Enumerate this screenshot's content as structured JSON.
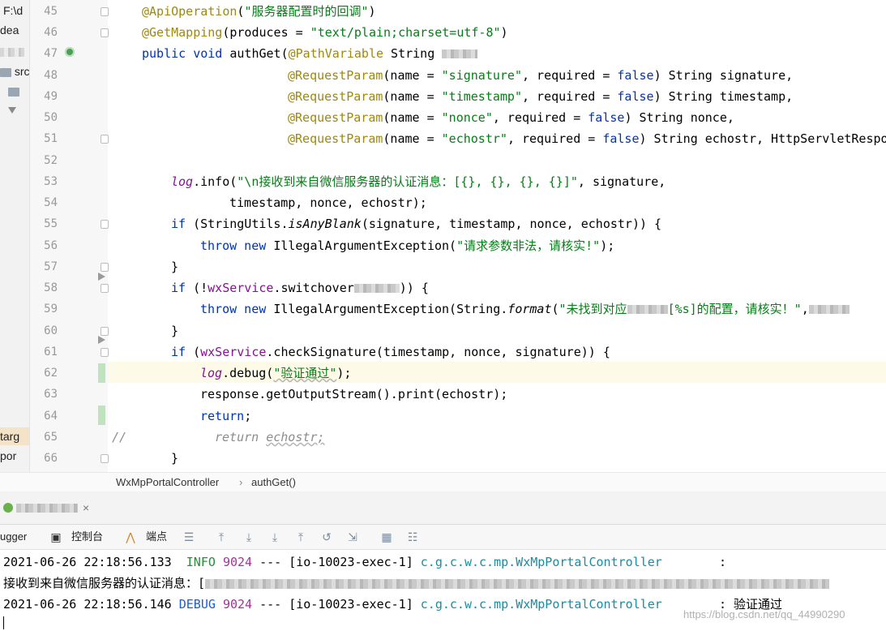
{
  "project": {
    "path_partial": "F:\\d",
    "idea_partial": "dea",
    "src_label": "src",
    "target_partial": "targ",
    "pom_partial": "por"
  },
  "editor": {
    "lines": [
      45,
      46,
      47,
      48,
      49,
      50,
      51,
      52,
      53,
      54,
      55,
      56,
      57,
      58,
      59,
      60,
      61,
      62,
      63,
      64,
      65,
      66
    ],
    "code": {
      "l45_ann": "@ApiOperation",
      "l45_p1": "(",
      "l45_str": "\"服务器配置时的回调\"",
      "l45_p2": ")",
      "l46_ann": "@GetMapping",
      "l46_p1": "(produces = ",
      "l46_str": "\"text/plain;charset=utf-8\"",
      "l46_p2": ")",
      "l47_kw": "public void ",
      "l47_name": "authGet(",
      "l47_ann": "@PathVariable",
      "l47_type": " String ",
      "l48_ann": "@RequestParam",
      "l48_p1": "(name = ",
      "l48_str": "\"signature\"",
      "l48_p2": ", required = ",
      "l48_kw": "false",
      "l48_p3": ") String signature,",
      "l49_ann": "@RequestParam",
      "l49_p1": "(name = ",
      "l49_str": "\"timestamp\"",
      "l49_p2": ", required = ",
      "l49_kw": "false",
      "l49_p3": ") String timestamp,",
      "l50_ann": "@RequestParam",
      "l50_p1": "(name = ",
      "l50_str": "\"nonce\"",
      "l50_p2": ", required = ",
      "l50_kw": "false",
      "l50_p3": ") String nonce,",
      "l51_ann": "@RequestParam",
      "l51_p1": "(name = ",
      "l51_str": "\"echostr\"",
      "l51_p2": ", required = ",
      "l51_kw": "false",
      "l51_p3": ") String echostr, HttpServletRespo",
      "l53_fld": "log",
      "l53_p1": ".info(",
      "l53_str": "\"\\n接收到来自微信服务器的认证消息：[{}, {}, {}, {}]\"",
      "l53_p2": ", signature,",
      "l54": "timestamp, nonce, echostr);",
      "l55_kw": "if ",
      "l55_p1": "(StringUtils.",
      "l55_it": "isAnyBlank",
      "l55_p2": "(signature, timestamp, nonce, echostr)) {",
      "l56_kw": "throw new ",
      "l56_p1": "IllegalArgumentException(",
      "l56_str": "\"请求参数非法，请核实!\"",
      "l56_p2": ");",
      "l57": "}",
      "l58_kw": "if ",
      "l58_p1": "(!",
      "l58_fld": "wxService",
      "l58_p2": ".switchover",
      "l58_p3": ")) {",
      "l59_kw": "throw new ",
      "l59_p1": "IllegalArgumentException(String.",
      "l59_it": "format",
      "l59_p2": "(",
      "l59_str1": "\"未找到对应",
      "l59_str2": "[%s]的配置，请核实！\"",
      "l59_p3": ",",
      "l60": "}",
      "l61_kw": "if ",
      "l61_p1": "(",
      "l61_fld": "wxService",
      "l61_p2": ".checkSignature(timestamp, nonce, signature)) {",
      "l62_fld": "log",
      "l62_p1": ".debug(",
      "l62_str": "\"验证通过\"",
      "l62_p2": ");",
      "l63": "response.getOutputStream().print(echostr);",
      "l64_kw": "return",
      "l64_p1": ";",
      "l65_cmt": "//",
      "l65_kw": "return ",
      "l65_var": "echostr;",
      "l66": "}"
    }
  },
  "breadcrumb": {
    "class_name": "WxMpPortalController",
    "separator": "›",
    "method_name": "authGet()"
  },
  "run_tab": {
    "close": "×"
  },
  "toolbar": {
    "debugger_label": "ugger",
    "console_label": "控制台",
    "breakpoints_label": "端点"
  },
  "console": {
    "line1_ts": "2021-06-26 22:18:56.133",
    "line1_level": " INFO",
    "line1_pid": "9024",
    "line1_mid": " --- [io-10023-exec-1] ",
    "line1_cls": "c.g.c.w.c.mp.WxMpPortalController",
    "line1_colon": ":",
    "line2_text": "接收到来自微信服务器的认证消息：[",
    "line3_ts": "2021-06-26 22:18:56.146",
    "line3_level": "DEBUG",
    "line3_pid": "9024",
    "line3_mid": " --- [io-10023-exec-1] ",
    "line3_cls": "c.g.c.w.c.mp.WxMpPortalController",
    "line3_msg": ": 验证通过"
  },
  "watermark": "https://blog.csdn.net/qq_44990290"
}
